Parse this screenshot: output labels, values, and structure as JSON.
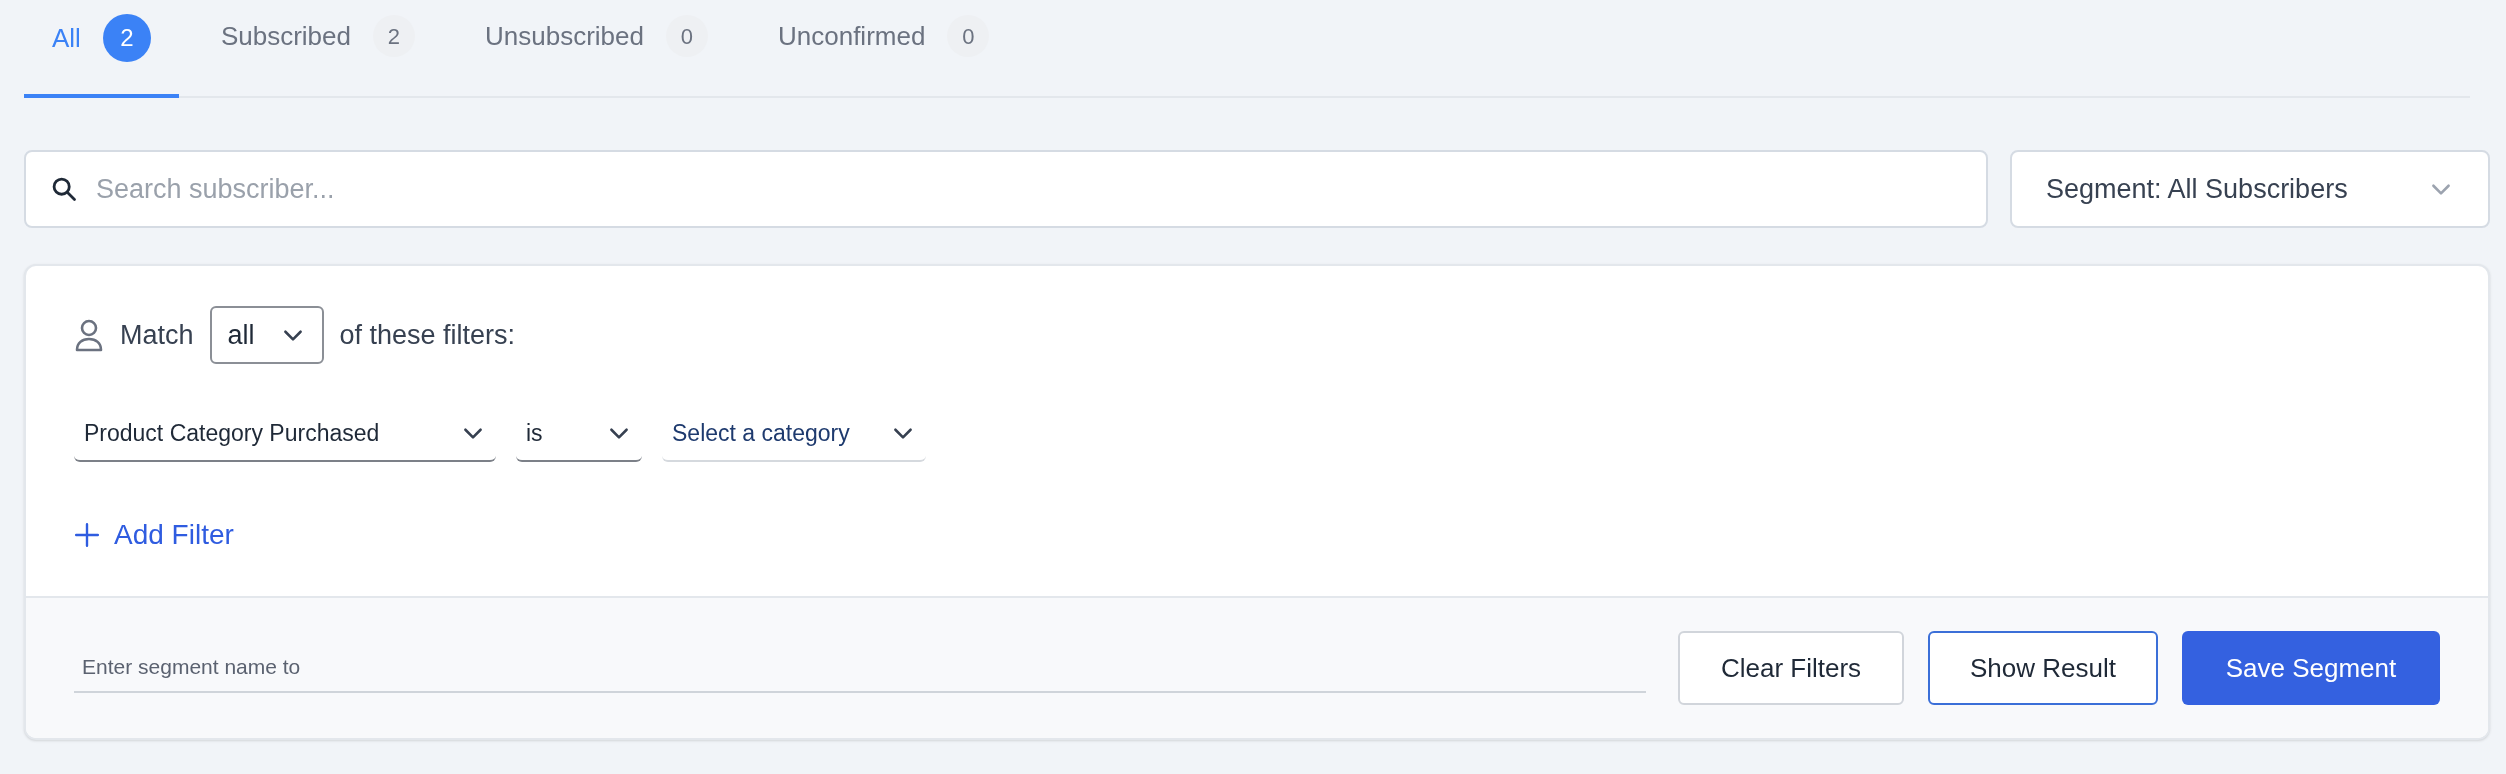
{
  "tabs": [
    {
      "label": "All",
      "count": "2",
      "selected": true
    },
    {
      "label": "Subscribed",
      "count": "2",
      "selected": false
    },
    {
      "label": "Unsubscribed",
      "count": "0",
      "selected": false
    },
    {
      "label": "Unconfirmed",
      "count": "0",
      "selected": false
    }
  ],
  "search": {
    "placeholder": "Search subscriber..."
  },
  "segment_dropdown": {
    "value": "Segment: All Subscribers"
  },
  "filters": {
    "match_prefix": "Match",
    "match_value": "all",
    "match_suffix": "of these filters:",
    "rows": [
      {
        "field": "Product Category Purchased",
        "operator": "is",
        "value": "Select a category"
      }
    ],
    "add_filter": "Add Filter"
  },
  "footer": {
    "segment_name": {
      "placeholder": "Enter segment name to"
    },
    "buttons": [
      {
        "label": "Clear Filters",
        "kind": "secondary"
      },
      {
        "label": "Show Result",
        "kind": "outline"
      },
      {
        "label": "Save Segment",
        "kind": "primary"
      }
    ]
  }
}
